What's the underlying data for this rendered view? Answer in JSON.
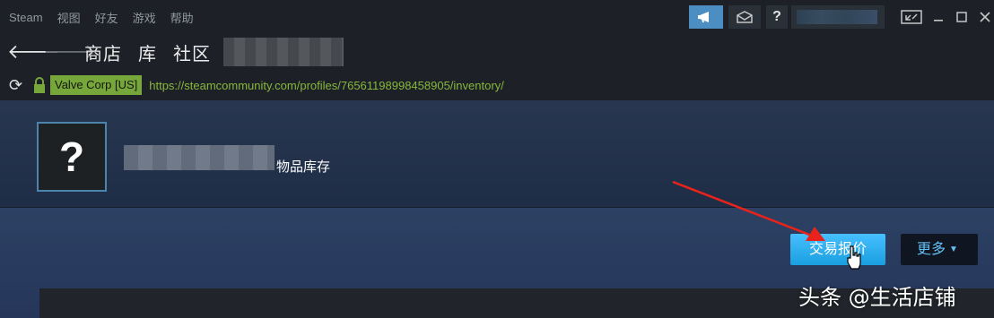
{
  "menubar": {
    "items": [
      "Steam",
      "视图",
      "好友",
      "游戏",
      "帮助"
    ],
    "help_label": "?"
  },
  "navbar": {
    "links": [
      "商店",
      "库",
      "社区"
    ]
  },
  "urlbar": {
    "certificate": "Valve Corp [US]",
    "url": "https://steamcommunity.com/profiles/76561198998458905/inventory/"
  },
  "profile": {
    "avatar_placeholder": "?",
    "inventory_title": "物品库存"
  },
  "actions": {
    "trade_offer_label": "交易报价",
    "more_label": "更多"
  },
  "watermark": "头条 @生活店铺",
  "colors": {
    "accent": "#47bfff",
    "url_green": "#86b83a",
    "cert_badge": "#77a63b",
    "annotation_red": "#e8231c"
  }
}
